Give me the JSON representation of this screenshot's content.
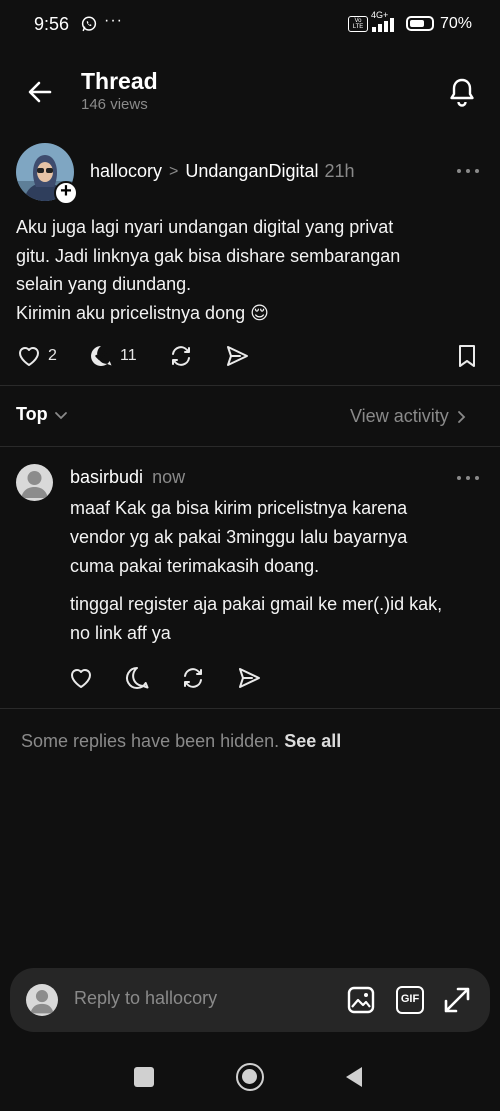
{
  "status_bar": {
    "time": "9:56",
    "dots": "···",
    "volte": "Vo LTE",
    "network": "4G+",
    "battery": "70%"
  },
  "header": {
    "title": "Thread",
    "views": "146 views"
  },
  "post": {
    "author": "hallocory",
    "separator": ">",
    "community": "UndanganDigital",
    "time": "21h",
    "lines": [
      "Aku juga lagi nyari undangan digital yang privat",
      "gitu. Jadi linknya gak bisa dishare sembarangan",
      "selain yang diundang.",
      "Kirimin aku pricelistnya dong 😌"
    ],
    "likes": "2",
    "replies": "11"
  },
  "sort": {
    "label": "Top",
    "view_activity": "View activity"
  },
  "reply": {
    "author": "basirbudi",
    "time": "now",
    "paragraph1": [
      "maaf Kak ga bisa kirim pricelistnya karena",
      "vendor yg ak pakai 3minggu lalu bayarnya",
      "cuma pakai terimakasih doang."
    ],
    "paragraph2": [
      "tinggal register aja pakai gmail ke mer(.)id kak,",
      "no link aff ya"
    ]
  },
  "hidden_note": {
    "text": "Some replies have been hidden.",
    "link": "See all"
  },
  "composer": {
    "placeholder": "Reply to hallocory",
    "gif_label": "GIF"
  },
  "icons": {
    "back": "arrow-left-icon",
    "bell": "bell-icon",
    "more": "more-horizontal-icon",
    "like": "heart-icon",
    "reply": "reply-icon",
    "repost": "repost-icon",
    "share": "send-icon",
    "bookmark": "bookmark-icon"
  },
  "colors": {
    "background": "#101010",
    "muted_text": "#8a8a8a",
    "composer_bg": "#262626"
  }
}
